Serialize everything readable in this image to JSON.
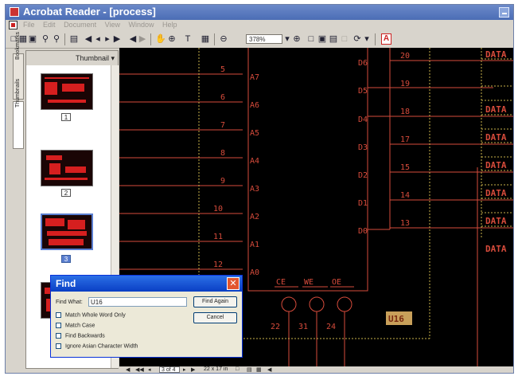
{
  "window": {
    "title": "Acrobat Reader - [process]"
  },
  "menu": {
    "items": [
      "File",
      "Edit",
      "Document",
      "View",
      "Window",
      "Help"
    ]
  },
  "toolbar": {
    "zoom_value": "378%"
  },
  "sidebar": {
    "tabs": [
      "Bookmarks",
      "Thumbnails"
    ],
    "header_label": "Thumbnail ▾",
    "thumbnails": [
      {
        "label": "1",
        "selected": false
      },
      {
        "label": "2",
        "selected": false
      },
      {
        "label": "3",
        "selected": true
      }
    ]
  },
  "statusbar": {
    "page_indicator": "3 of 4",
    "page_size": "22 x 17 in"
  },
  "find_dialog": {
    "title": "Find",
    "find_what_label": "Find What:",
    "find_what_value": "U16",
    "find_again_button": "Find Again",
    "cancel_button": "Cancel",
    "options": [
      {
        "label": "Match Whole Word Only",
        "checked": false
      },
      {
        "label": "Match Case",
        "checked": false
      },
      {
        "label": "Find Backwards",
        "checked": false
      },
      {
        "label": "Ignore Asian Character Width",
        "checked": false
      }
    ]
  },
  "schematic": {
    "pin_numbers": [
      "5",
      "6",
      "7",
      "8",
      "9",
      "10",
      "11",
      "12"
    ],
    "address_pins": [
      "A7",
      "A6",
      "A5",
      "A4",
      "A3",
      "A2",
      "A1",
      "A0"
    ],
    "data_pins": [
      "D6",
      "D5",
      "D4",
      "D3",
      "D2",
      "D1",
      "D0"
    ],
    "right_pin_numbers": [
      "20",
      "19",
      "18",
      "17",
      "15",
      "14",
      "13"
    ],
    "data_labels": [
      "DATA",
      "DATA",
      "DATA",
      "DATA",
      "DATA",
      "DATA",
      "DATA"
    ],
    "control_pins": [
      "CE",
      "WE",
      "OE"
    ],
    "control_pin_numbers": [
      "22",
      "31",
      "24"
    ],
    "chip_label": "U16"
  },
  "colors": {
    "schematic_red": "#d64b3b",
    "title_blue": "#4b6db5",
    "dialog_blue": "#0a3fc4",
    "highlight": "#c8a05a"
  }
}
